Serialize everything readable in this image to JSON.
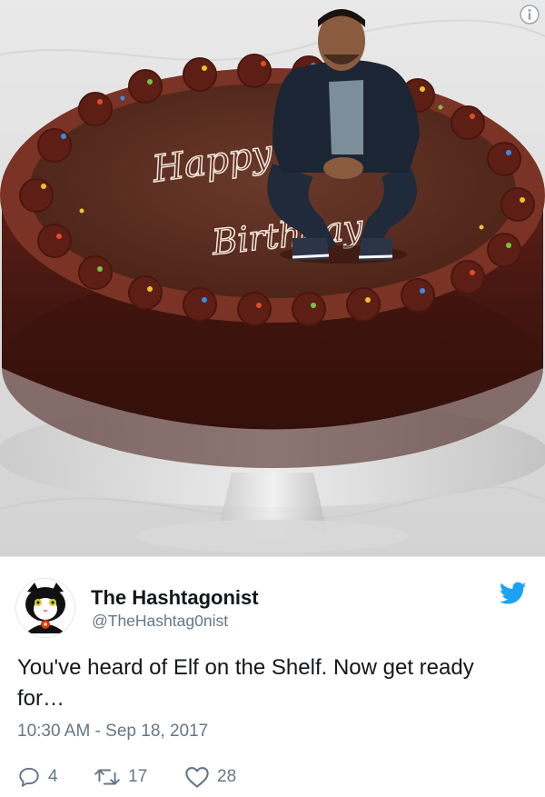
{
  "tweet": {
    "display_name": "The Hashtagonist",
    "handle": "@TheHashtag0nist",
    "text": "You've heard of Elf on the Shelf. Now get ready for…",
    "timestamp": "10:30 AM - Sep 18, 2017"
  },
  "media": {
    "cake_writing_line1": "Happy",
    "cake_writing_line2": "Birthday",
    "info_icon": "info-icon"
  },
  "actions": {
    "replies": "4",
    "retweets": "17",
    "likes": "28"
  },
  "icons": {
    "reply": "reply-icon",
    "retweet": "retweet-icon",
    "like": "heart-icon",
    "platform": "twitter-bird-icon"
  },
  "colors": {
    "twitter_blue": "#1da1f2",
    "secondary_text": "#657786",
    "primary_text": "#14171a",
    "cake_frosting": "#5a2d20",
    "cake_side": "#3a1410"
  }
}
